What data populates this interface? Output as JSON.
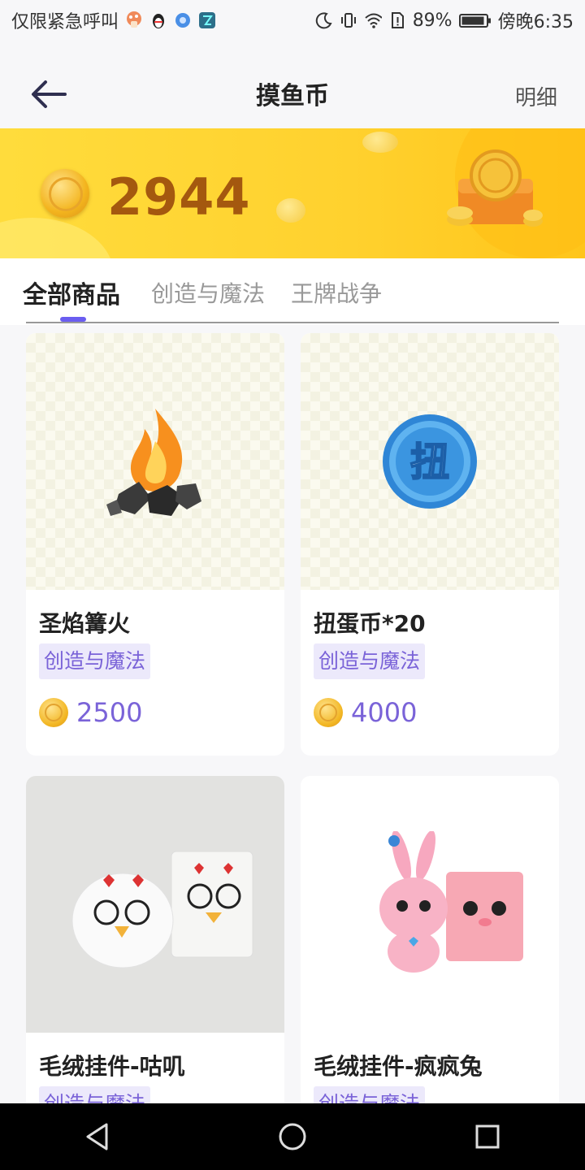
{
  "status_bar": {
    "left_text": "仅限紧急呼叫",
    "battery": "89%",
    "time": "傍晚6:35",
    "app_icons": [
      "mushroom-app-icon",
      "qq-penguin-icon",
      "blue-globe-icon",
      "teal-app-icon"
    ],
    "system_icons": [
      "moon-icon",
      "vibrate-icon",
      "wifi-icon",
      "sim-icon",
      "battery-icon"
    ]
  },
  "header": {
    "title": "摸鱼币",
    "detail_label": "明细",
    "back_icon": "back-arrow-icon"
  },
  "balance": {
    "value": "2944"
  },
  "tabs": [
    {
      "label": "全部商品",
      "active": true
    },
    {
      "label": "创造与魔法",
      "active": false
    },
    {
      "label": "王牌战争",
      "active": false
    }
  ],
  "products": [
    {
      "title": "圣焰篝火",
      "tag": "创造与魔法",
      "price": "2500",
      "image": "campfire-image"
    },
    {
      "title": "扭蛋币*20",
      "tag": "创造与魔法",
      "price": "4000",
      "image": "gacha-coin-image",
      "coin_char": "扭"
    },
    {
      "title": "毛绒挂件-咕叽",
      "tag": "创造与魔法",
      "price": "",
      "image": "plush-chick-image"
    },
    {
      "title": "毛绒挂件-疯疯兔",
      "tag": "创造与魔法",
      "price": "",
      "image": "plush-rabbit-image"
    }
  ],
  "colors": {
    "accent": "#6a5df0",
    "tag_text": "#7a63d8",
    "tag_bg": "#ece9fb",
    "banner": "#ffd12e",
    "balance_text": "#a4580f"
  },
  "nav_bar": [
    "back-triangle-icon",
    "home-circle-icon",
    "recents-square-icon"
  ]
}
